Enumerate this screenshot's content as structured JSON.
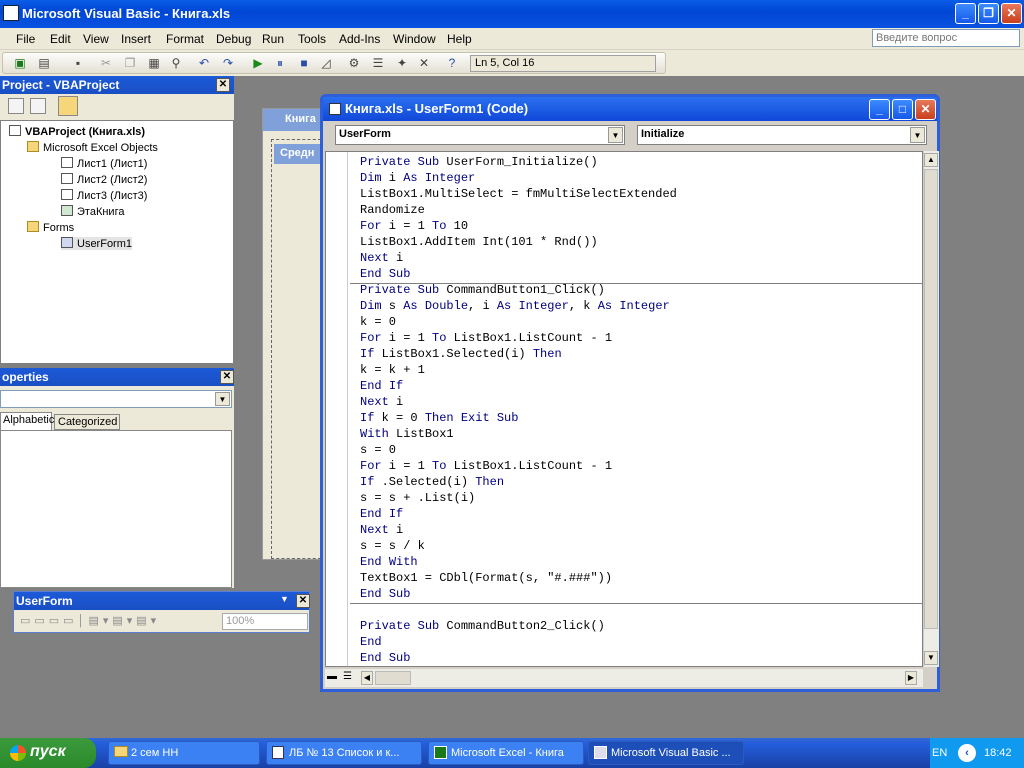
{
  "app": {
    "title": "Microsoft Visual Basic - Книга.xls"
  },
  "menubar": {
    "items": [
      "File",
      "Edit",
      "View",
      "Insert",
      "Format",
      "Debug",
      "Run",
      "Tools",
      "Add-Ins",
      "Window",
      "Help"
    ],
    "ask_placeholder": "Введите вопрос"
  },
  "toolbar": {
    "position": "Ln 5, Col 16"
  },
  "project": {
    "title": "Project - VBAProject",
    "tree": [
      "VBAProject (Книга.xls)",
      "Microsoft Excel Objects",
      "Лист1 (Лист1)",
      "Лист2 (Лист2)",
      "Лист3 (Лист3)",
      "ЭтаКнига",
      "Forms",
      "UserForm1"
    ]
  },
  "properties": {
    "title": "operties",
    "tabs": [
      "Alphabetic",
      "Categorized"
    ]
  },
  "userform_toolbar": {
    "title": "UserForm",
    "zoom": "100%"
  },
  "designer": {
    "title": "Книга",
    "caption": "Средн"
  },
  "code_window": {
    "title": "Книга.xls - UserForm1 (Code)",
    "object": "UserForm",
    "procedure": "Initialize",
    "procedures": [
      [
        "Private Sub UserForm_Initialize()",
        "Dim i As Integer",
        "ListBox1.MultiSelect = fmMultiSelectExtended",
        "Randomize",
        "For i = 1 To 10",
        "ListBox1.AddItem Int(101 * Rnd())",
        "Next i",
        "End Sub"
      ],
      [
        "Private Sub CommandButton1_Click()",
        "Dim s As Double, i As Integer, k As Integer",
        "k = 0",
        "For i = 1 To ListBox1.ListCount - 1",
        "If ListBox1.Selected(i) Then",
        "k = k + 1",
        "End If",
        "Next i",
        "If k = 0 Then Exit Sub",
        "With ListBox1",
        "s = 0",
        "For i = 1 To ListBox1.ListCount - 1",
        "If .Selected(i) Then",
        "s = s + .List(i)",
        "End If",
        "Next i",
        "s = s / k",
        "End With",
        "TextBox1 = CDbl(Format(s, \"#.###\"))",
        "End Sub"
      ],
      [
        "",
        "Private Sub CommandButton2_Click()",
        "End",
        "End Sub"
      ]
    ]
  },
  "taskbar": {
    "start": "пуск",
    "tasks": [
      "2 сем НН",
      "ЛБ № 13 Список и к...",
      "Microsoft Excel - Книга",
      "Microsoft Visual Basic ..."
    ],
    "lang": "EN",
    "clock": "18:42"
  },
  "colors": {
    "keyword": "#00007f",
    "titlebar": "#0a52e0"
  }
}
